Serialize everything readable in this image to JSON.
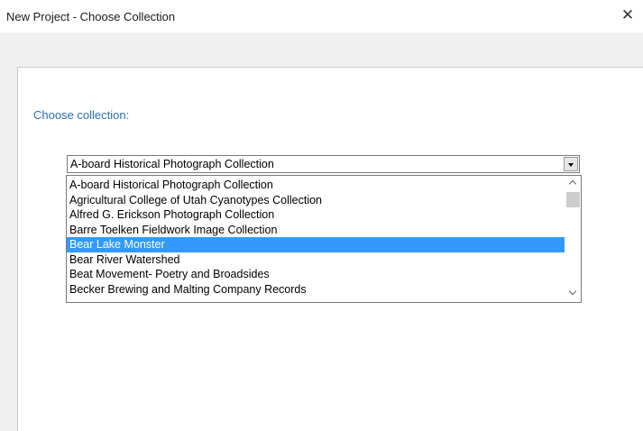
{
  "window": {
    "title": "New Project - Choose Collection",
    "close_glyph": "✕"
  },
  "panel": {
    "heading": "Choose collection:"
  },
  "collection_select": {
    "selected_value": "A-board Historical Photograph Collection",
    "options": [
      "A-board Historical Photograph Collection",
      "Agricultural College of Utah Cyanotypes Collection",
      "Alfred G. Erickson Photograph Collection",
      "Barre Toelken Fieldwork Image Collection",
      "Bear Lake Monster",
      "Bear River Watershed",
      "Beat Movement- Poetry and Broadsides",
      "Becker Brewing and Malting Company Records"
    ],
    "highlighted_option": "Bear Lake Monster"
  },
  "colors": {
    "accent": "#2a6fb0",
    "selection": "#3399ff",
    "chrome": "#f0f0f0"
  },
  "icons": {
    "close": "close-icon",
    "dropdown": "chevron-down-icon",
    "scroll_up": "chevron-up-icon",
    "scroll_down": "chevron-down-icon"
  }
}
